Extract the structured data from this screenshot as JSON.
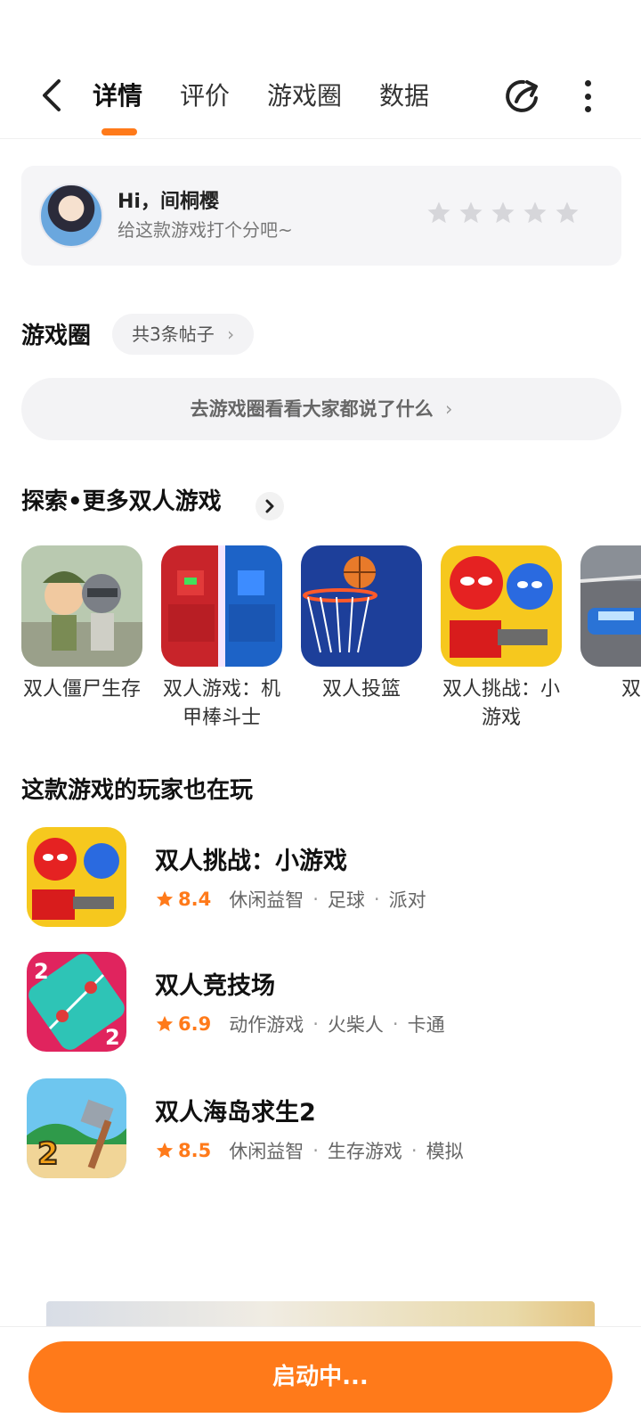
{
  "header": {
    "tabs": [
      {
        "label": "详情",
        "active": true
      },
      {
        "label": "评价",
        "active": false
      },
      {
        "label": "游戏圈",
        "active": false
      },
      {
        "label": "数据",
        "active": false
      }
    ],
    "icons": {
      "back": "chevron-left-icon",
      "share": "share-icon",
      "more": "more-vertical-icon"
    },
    "accent_color": "#ff7a1a"
  },
  "rating_prompt": {
    "greeting": "Hi，间桐樱",
    "subtitle": "给这款游戏打个分吧~",
    "stars": 5,
    "rating": 0
  },
  "game_circle": {
    "title": "游戏圈",
    "post_count_label": "共3条帖子",
    "browse_label": "去游戏圈看看大家都说了什么"
  },
  "explore": {
    "title": "探索•更多双人游戏",
    "items": [
      {
        "name": "双人僵尸生存"
      },
      {
        "name": "双人游戏：机甲棒斗士"
      },
      {
        "name": "双人投篮"
      },
      {
        "name": "双人挑战：小游戏"
      },
      {
        "name": "双人"
      }
    ]
  },
  "also_played": {
    "title": "这款游戏的玩家也在玩",
    "items": [
      {
        "title": "双人挑战：小游戏",
        "score": "8.4",
        "tags": [
          "休闲益智",
          "足球",
          "派对"
        ]
      },
      {
        "title": "双人竞技场",
        "score": "6.9",
        "tags": [
          "动作游戏",
          "火柴人",
          "卡通"
        ]
      },
      {
        "title": "双人海岛求生2",
        "score": "8.5",
        "tags": [
          "休闲益智",
          "生存游戏",
          "模拟"
        ]
      }
    ]
  },
  "bottom": {
    "launch_label": "启动中..."
  }
}
